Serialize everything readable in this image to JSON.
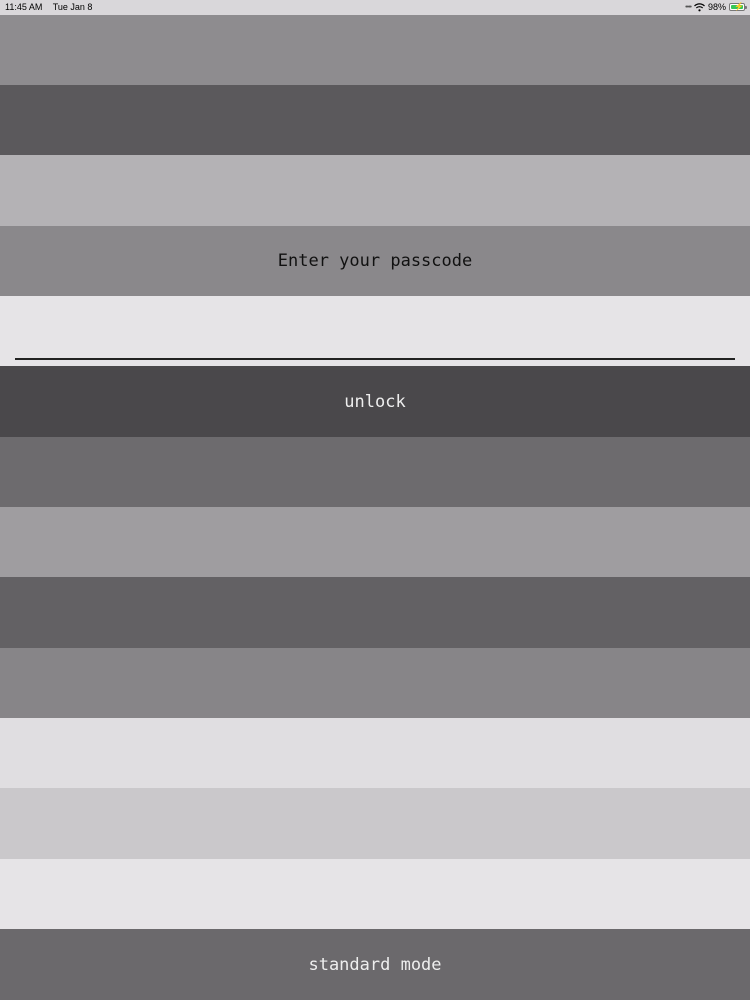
{
  "status_bar": {
    "time": "11:45 AM",
    "date": "Tue Jan 8",
    "signal_icon": "signal-dots-icon",
    "wifi_icon": "wifi-icon",
    "battery_percent": "98%",
    "battery_level": 0.98,
    "battery_icon": "battery-charging-icon"
  },
  "lock_screen": {
    "prompt": "Enter your passcode",
    "passcode_value": "",
    "passcode_placeholder": "",
    "unlock_label": "unlock",
    "standard_mode_label": "standard mode"
  },
  "colors": {
    "band_1": "#8e8c8f",
    "band_2": "#5b595c",
    "band_3": "#b4b2b5",
    "prompt_band": "#8a888b",
    "input_band": "#e6e4e7",
    "unlock_band": "#4a484b",
    "band_7": "#6d6b6e",
    "band_8": "#9f9da0",
    "band_9": "#636164",
    "band_10": "#878588",
    "band_11": "#e0dee1",
    "band_12": "#cac8cb",
    "band_13": "#e6e4e7",
    "standard_mode_band": "#6b696c",
    "battery_fill": "#34c759"
  }
}
